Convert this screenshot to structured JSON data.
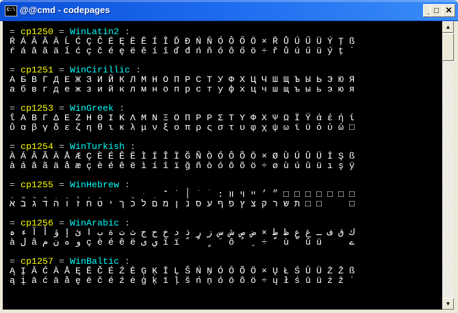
{
  "window": {
    "title": "@@cmd - codepages",
    "icon": "console-icon",
    "buttons": {
      "minimize": "_",
      "maximize": "□",
      "close": "✕"
    }
  },
  "colors": {
    "codepage": "#ffff00",
    "name": "#00ffff",
    "text": "#c0c0c0"
  },
  "sections": [
    {
      "cp": "cp1250",
      "name": "WinLatin2",
      "upper": "ŔÁÂĂÄĹĆÇČÉĘËĚÍÎĎĐŃŇÓÔŐÖ×ŘŮÚŰÜÝŢß",
      "lower": "ŕáâăäĺćçčéęëěíîďđńňóôőö÷řůúűüýţ˙"
    },
    {
      "cp": "cp1251",
      "name": "WinCirillic",
      "upper": "АБВГДЕЖЗИЙКЛМНОПРСТУФХЦЧШЩЪЫЬЭЮЯ",
      "lower": "абвгдежзийклмнопрстуфхцчшщъыьэюя"
    },
    {
      "cp": "cp1253",
      "name": "WinGreek",
      "upper": "ΐΑΒΓΔΕΖΗΘΙΚΛΜΝΞΟΠΡΡΣΤΥΦΧΨΩΪΫάέήί",
      "lower": "ΰαβγδεζηθικλμνξοπρςστυφχψωϊϋόύώ□"
    },
    {
      "cp": "cp1254",
      "name": "WinTurkish",
      "upper": "ÀÁÂÃÄÅÆÇÈÉÊËÌÍÎÏĞÑÒÓÔÕÖ×ØÙÚÛÜİŞß",
      "lower": "àáâãäåæçèéêëìíîïğñòóôõö÷øùúûüışÿ"
    },
    {
      "cp": "cp1255",
      "name": "WinHebrew",
      "upper": "ְֱֲֳִֵֶַָֹ ֻּֽ־ֿ׀ׁׂ׃װױײ׳״□□□□□□□",
      "lower": "אבגדהוזחטיךכלםמןנסעףפץצקרשת□□  □"
    },
    {
      "cp": "cp1256",
      "name": "WinArabic",
      "upper": "ہءآأؤإئابةتثجحخدذرزسشصض×طظعغـفقك",
      "lower": "àلâمنهوçèéêëىيîïًٌٍَôُِ÷ّùْûü  ے"
    },
    {
      "cp": "cp1257",
      "name": "WinBaltic",
      "upper": "ĄĮĀĆÄÅĘĒČÉŹĖĢĶĪĻŠŃŅÓŌÕÖ×ŲŁŚŪÜŻŽß",
      "lower": "ąįāćäåęēčéźėģķīļšńņóōõö÷ųłśūüżž˙"
    }
  ]
}
